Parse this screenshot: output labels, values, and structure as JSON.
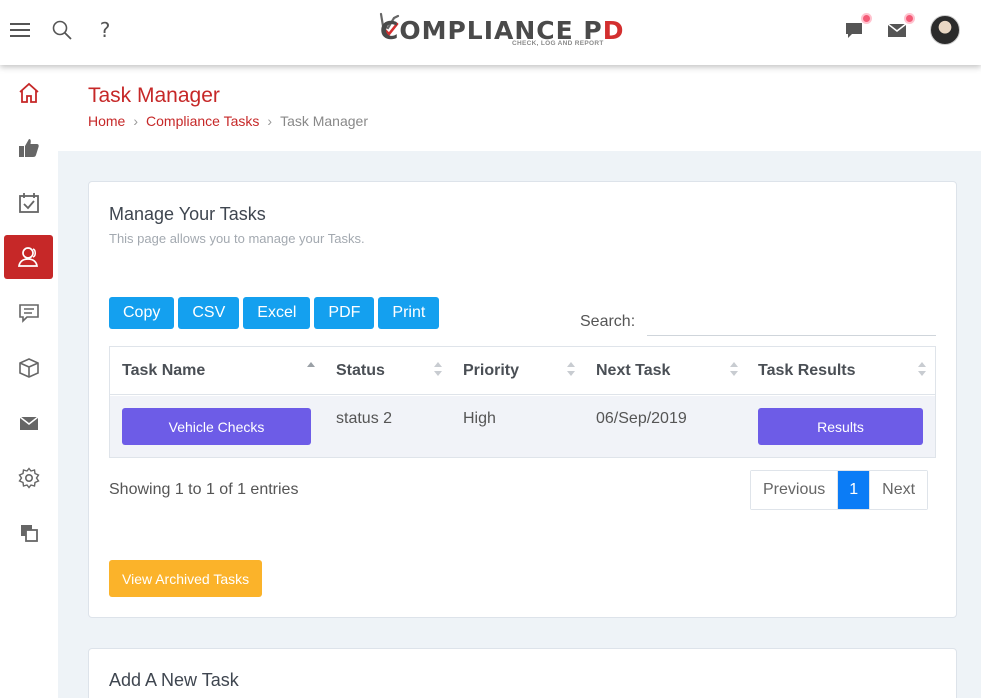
{
  "topbar": {
    "help_glyph": "?",
    "logo": {
      "text_part1": "COMPLIANCE P",
      "text_part2": "D",
      "tagline": "CHECK, LOG AND REPORT"
    },
    "icons": [
      "menu-icon",
      "search-icon",
      "help-icon",
      "chat-icon",
      "mail-icon",
      "avatar"
    ]
  },
  "sidebar": {
    "items": [
      "home-icon",
      "thumbs-up-icon",
      "calendar-check-icon",
      "users-icon",
      "message-icon",
      "box-icon",
      "mail-icon",
      "gear-icon",
      "copy-icon"
    ],
    "active_index": 3
  },
  "header": {
    "title": "Task Manager",
    "breadcrumb": [
      "Home",
      "Compliance Tasks",
      "Task Manager"
    ]
  },
  "card": {
    "title": "Manage Your Tasks",
    "subtitle": "This page allows you to manage your Tasks.",
    "export_buttons": [
      "Copy",
      "CSV",
      "Excel",
      "PDF",
      "Print"
    ],
    "search_label": "Search:",
    "search_value": "",
    "columns": [
      "Task Name",
      "Status",
      "Priority",
      "Next Task",
      "Task Results"
    ],
    "rows": [
      {
        "task_name": "Vehicle Checks",
        "status": "status 2",
        "priority": "High",
        "next_task": "06/Sep/2019",
        "results": "Results"
      }
    ],
    "info": "Showing 1 to 1 of 1 entries",
    "pager": {
      "previous": "Previous",
      "current": "1",
      "next": "Next"
    },
    "archive_button": "View Archived Tasks"
  },
  "card2": {
    "title": "Add A New Task"
  },
  "colors": {
    "accent": "#c62828",
    "export_blue": "#14a0ef",
    "purple": "#6d5ce7",
    "amber": "#fbb32a",
    "page_blue": "#0b7cf6"
  }
}
